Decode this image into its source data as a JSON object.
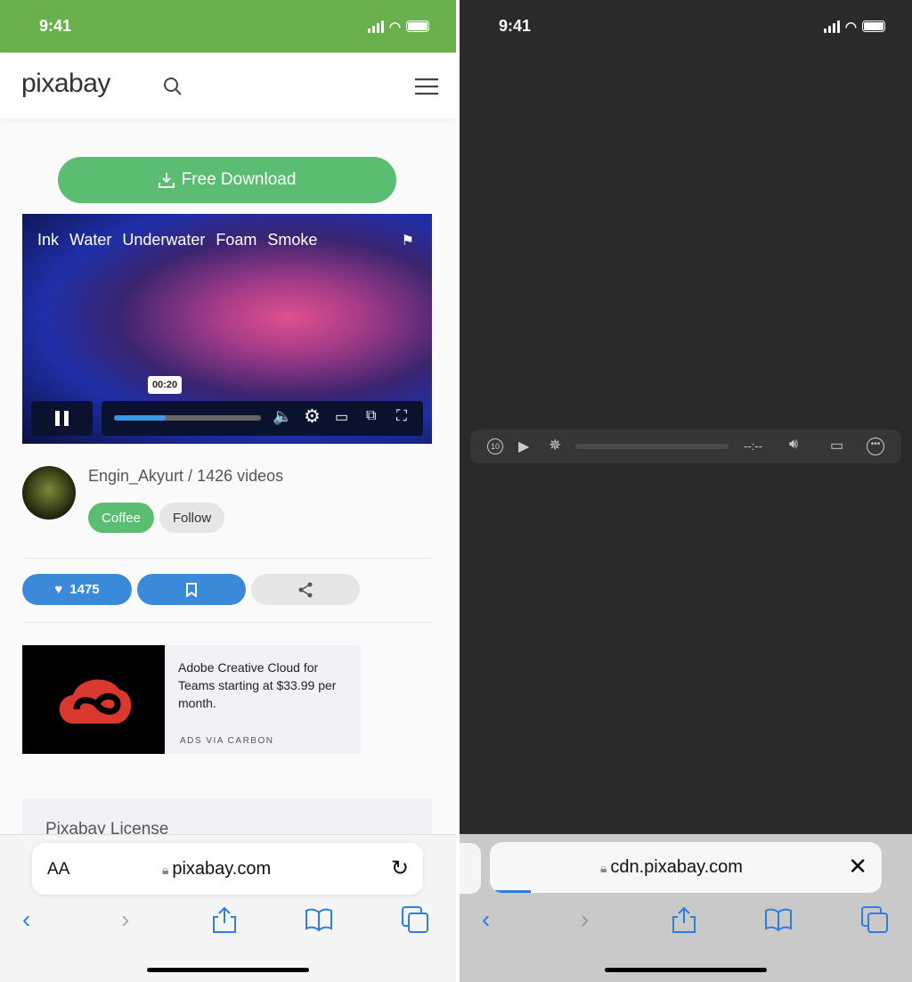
{
  "left": {
    "status": {
      "time": "9:41",
      "bg": "#6ab04c"
    },
    "header": {
      "logo": "pixabay"
    },
    "download_label": "Free Download",
    "video": {
      "tags": [
        "Ink",
        "Water",
        "Underwater",
        "Foam",
        "Smoke"
      ],
      "time_tooltip": "00:20",
      "progress": 0.35
    },
    "author": {
      "line": "Engin_Akyurt / 1426 videos",
      "coffee": "Coffee",
      "follow": "Follow"
    },
    "actions": {
      "likes": "1475"
    },
    "ad": {
      "text": "Adobe Creative Cloud for Teams starting at $33.99 per month.",
      "via": "ADS VIA CARBON"
    },
    "license_title": "Pixabay License",
    "url_bar": {
      "aa": "AA",
      "url": "pixabay.com"
    }
  },
  "right": {
    "status": {
      "time": "9:41"
    },
    "player": {
      "skip": "10",
      "time": "--:--"
    },
    "url_bar": {
      "url": "cdn.pixabay.com"
    }
  },
  "colors": {
    "green": "#5bbd72",
    "blue": "#3b8ad9",
    "ios_blue": "#2f7de1"
  }
}
